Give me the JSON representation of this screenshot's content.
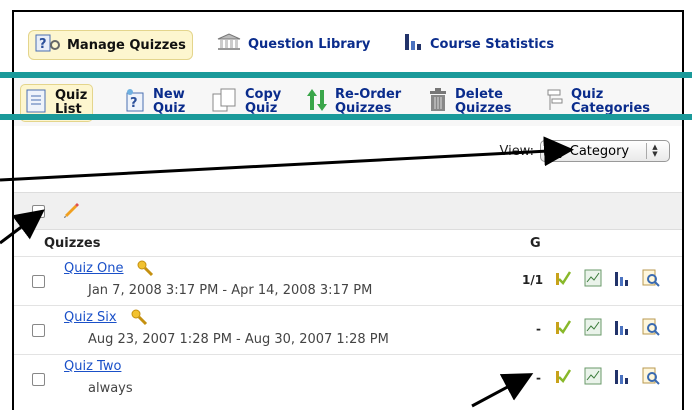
{
  "topnav": {
    "tabs": [
      {
        "label": "Manage Quizzes",
        "icon": "question-gear-icon"
      },
      {
        "label": "Question Library",
        "icon": "library-building-icon"
      },
      {
        "label": "Course Statistics",
        "icon": "bar-chart-icon"
      }
    ]
  },
  "toolbar": {
    "items": [
      {
        "label": "Quiz\nList",
        "icon": "list-icon"
      },
      {
        "label": "New\nQuiz",
        "icon": "new-quiz-icon"
      },
      {
        "label": "Copy\nQuiz",
        "icon": "copy-icon"
      },
      {
        "label": "Re-Order\nQuizzes",
        "icon": "reorder-arrows-icon"
      },
      {
        "label": "Delete\nQuizzes",
        "icon": "trash-icon"
      },
      {
        "label": "Quiz\nCategories",
        "icon": "categories-icon"
      }
    ]
  },
  "view": {
    "label": "View:",
    "selected": "By Category"
  },
  "table": {
    "col_quizzes": "Quizzes",
    "col_g": "G",
    "rows": [
      {
        "title": "Quiz One",
        "date": "Jan 7, 2008 3:17 PM - Apr 14, 2008 3:17 PM",
        "g": "1/1"
      },
      {
        "title": "Quiz Six",
        "date": "Aug 23, 2007 1:28 PM - Aug 30, 2007 1:28 PM",
        "g": "-"
      },
      {
        "title": "Quiz Two",
        "date": "always",
        "g": "-"
      }
    ]
  },
  "colors": {
    "teal": "#1a9a9a",
    "link": "#1a50c8",
    "highlight": "#fdf6cf"
  }
}
